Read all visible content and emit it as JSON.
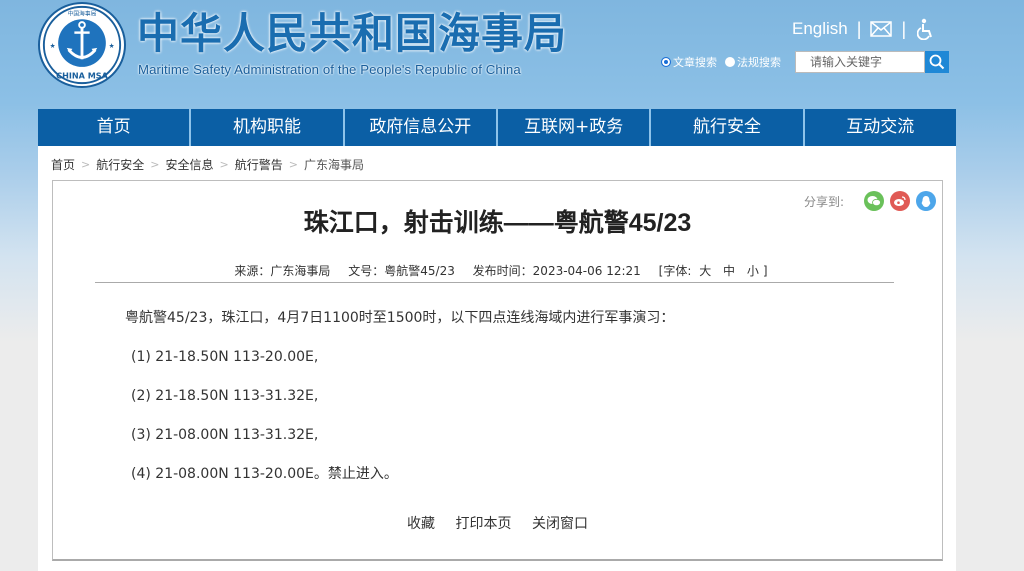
{
  "header": {
    "logo_text": "CHINA MSA",
    "logo_top_text": "中国海事局",
    "title": "中华人民共和国海事局",
    "subtitle": "Maritime Safety Administration of the People's Republic of China",
    "english_link": "English",
    "separator": "|",
    "search": {
      "options": [
        {
          "label": "文章搜索",
          "checked": true
        },
        {
          "label": "法规搜索",
          "checked": false
        }
      ],
      "placeholder": "请输入关键字"
    }
  },
  "nav": {
    "items": [
      {
        "label": "首页"
      },
      {
        "label": "机构职能"
      },
      {
        "label": "政府信息公开"
      },
      {
        "label": "互联网+政务"
      },
      {
        "label": "航行安全"
      },
      {
        "label": "互动交流"
      }
    ]
  },
  "breadcrumb": {
    "items": [
      "首页",
      "航行安全",
      "安全信息",
      "航行警告",
      "广东海事局"
    ],
    "separator": ">"
  },
  "article": {
    "share_label": "分享到:",
    "share_targets": [
      "wechat",
      "weibo",
      "qq"
    ],
    "title": "珠江口，射击训练——粤航警45/23",
    "meta": {
      "source": "来源：广东海事局",
      "doc_no": "文号：粤航警45/23",
      "published": "发布时间：2023-04-06 12:21",
      "font_label": "[字体:",
      "font_large": "大",
      "font_medium": "中",
      "font_small": "小",
      "font_close": "]"
    },
    "intro": "粤航警45/23，珠江口，4月7日1100时至1500时，以下四点连线海域内进行军事演习：",
    "points": [
      "(1)  21-18.50N 113-20.00E,",
      "(2)  21-18.50N 113-31.32E,",
      "(3)  21-08.00N 113-31.32E,",
      "(4)  21-08.00N 113-20.00E。禁止进入。"
    ],
    "actions": {
      "favorite": "收藏",
      "print": "打印本页",
      "close": "关闭窗口"
    }
  }
}
